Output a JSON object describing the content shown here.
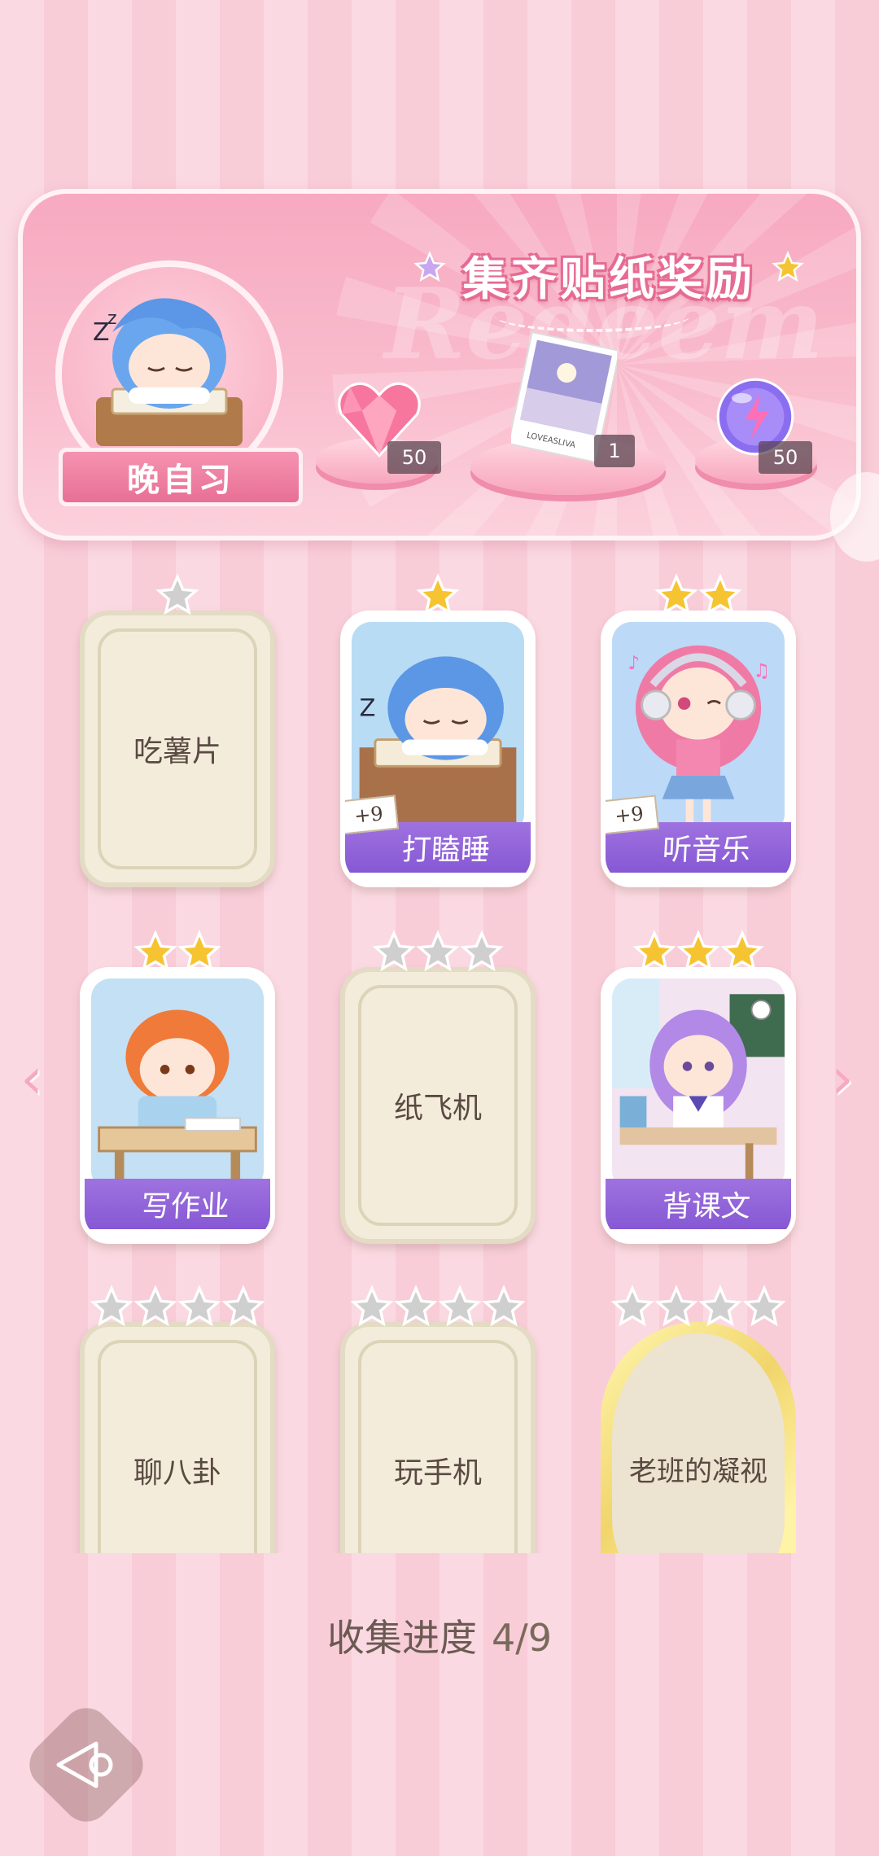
{
  "banner": {
    "title": "集齐贴纸奖励",
    "watermark": "Redeem",
    "avatar_label": "晚自习",
    "rewards": [
      {
        "icon": "pink-heart-gem-icon",
        "count": "50"
      },
      {
        "icon": "photo-card-icon",
        "count": "1",
        "card_caption": "LOVEASLIVA"
      },
      {
        "icon": "purple-energy-orb-icon",
        "count": "50"
      }
    ]
  },
  "cards": [
    {
      "name": "吃薯片",
      "stars": 1,
      "earned_stars": 0,
      "state": "locked"
    },
    {
      "name": "打瞌睡",
      "stars": 1,
      "earned_stars": 1,
      "state": "unlocked",
      "bonus": "+9"
    },
    {
      "name": "听音乐",
      "stars": 2,
      "earned_stars": 2,
      "state": "unlocked",
      "bonus": "+9"
    },
    {
      "name": "写作业",
      "stars": 2,
      "earned_stars": 2,
      "state": "unlocked"
    },
    {
      "name": "纸飞机",
      "stars": 3,
      "earned_stars": 0,
      "state": "locked"
    },
    {
      "name": "背课文",
      "stars": 3,
      "earned_stars": 3,
      "state": "unlocked"
    },
    {
      "name": "聊八卦",
      "stars": 4,
      "earned_stars": 0,
      "state": "locked"
    },
    {
      "name": "玩手机",
      "stars": 4,
      "earned_stars": 0,
      "state": "locked"
    },
    {
      "name": "老班的凝视",
      "stars": 4,
      "earned_stars": 0,
      "state": "locked-special"
    }
  ],
  "progress": {
    "label": "收集进度",
    "value": "4/9"
  },
  "colors": {
    "accent_purple": "#8658d4",
    "pink": "#f7a9c0",
    "gold_star": "#f6c431",
    "grey_star": "#c9c9c9"
  }
}
